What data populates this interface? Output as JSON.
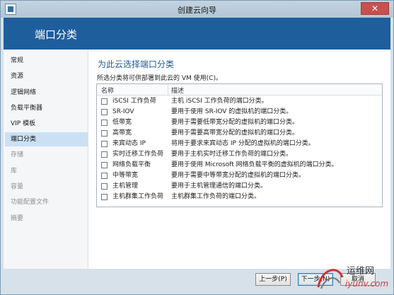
{
  "window": {
    "title": "创建云向导",
    "close_glyph": "✕"
  },
  "header": {
    "title": "端口分类"
  },
  "nav": {
    "items": [
      {
        "label": "常规",
        "state": "normal"
      },
      {
        "label": "资源",
        "state": "normal"
      },
      {
        "label": "逻辑网络",
        "state": "normal"
      },
      {
        "label": "负载平衡器",
        "state": "normal"
      },
      {
        "label": "VIP 模板",
        "state": "normal"
      },
      {
        "label": "端口分类",
        "state": "active"
      },
      {
        "label": "存储",
        "state": "disabled"
      },
      {
        "label": "库",
        "state": "disabled"
      },
      {
        "label": "容量",
        "state": "disabled"
      },
      {
        "label": "功能配置文件",
        "state": "disabled"
      },
      {
        "label": "摘要",
        "state": "disabled"
      }
    ]
  },
  "main": {
    "section_title": "为此云选择端口分类",
    "instruction": "所选分类将可供部署到此云的 VM 使用(C)。",
    "table": {
      "columns": [
        "名称",
        "描述"
      ],
      "rows": [
        {
          "name": "iSCSI 工作负荷",
          "desc": "主机 iSCSI 工作负荷的端口分类。",
          "checked": false
        },
        {
          "name": "SR-IOV",
          "desc": "要用于使用 SR-IOV 的虚拟机的端口分类。",
          "checked": false
        },
        {
          "name": "低带宽",
          "desc": "要用于需要低带宽分配的虚拟机的端口分类。",
          "checked": false
        },
        {
          "name": "高带宽",
          "desc": "要用于需要高带宽分配的虚拟机的端口分类。",
          "checked": false
        },
        {
          "name": "来宾动态 IP",
          "desc": "将用于要求来宾动态 IP 分配的虚拟机的端口分类。",
          "checked": false
        },
        {
          "name": "实时迁移工作负荷",
          "desc": "要用于主机实时迁移工作负荷的端口分类。",
          "checked": false
        },
        {
          "name": "网络负载平衡",
          "desc": "要用于使用 Microsoft 网络负载平衡的虚拟机的端口分类。",
          "checked": false
        },
        {
          "name": "中等带宽",
          "desc": "要用于需要中等带宽分配的虚拟机的端口分类。",
          "checked": false
        },
        {
          "name": "主机管理",
          "desc": "要用于主机管理通信的端口分类。",
          "checked": false
        },
        {
          "name": "主机群集工作负荷",
          "desc": "主机群集工作负荷的端口分类。",
          "checked": false
        }
      ]
    }
  },
  "footer": {
    "prev_label": "上一步(P)",
    "next_label": "下一步(N)",
    "cancel_label": "取消"
  },
  "watermark": {
    "cn": "运维网",
    "en": "iyunv.com"
  }
}
